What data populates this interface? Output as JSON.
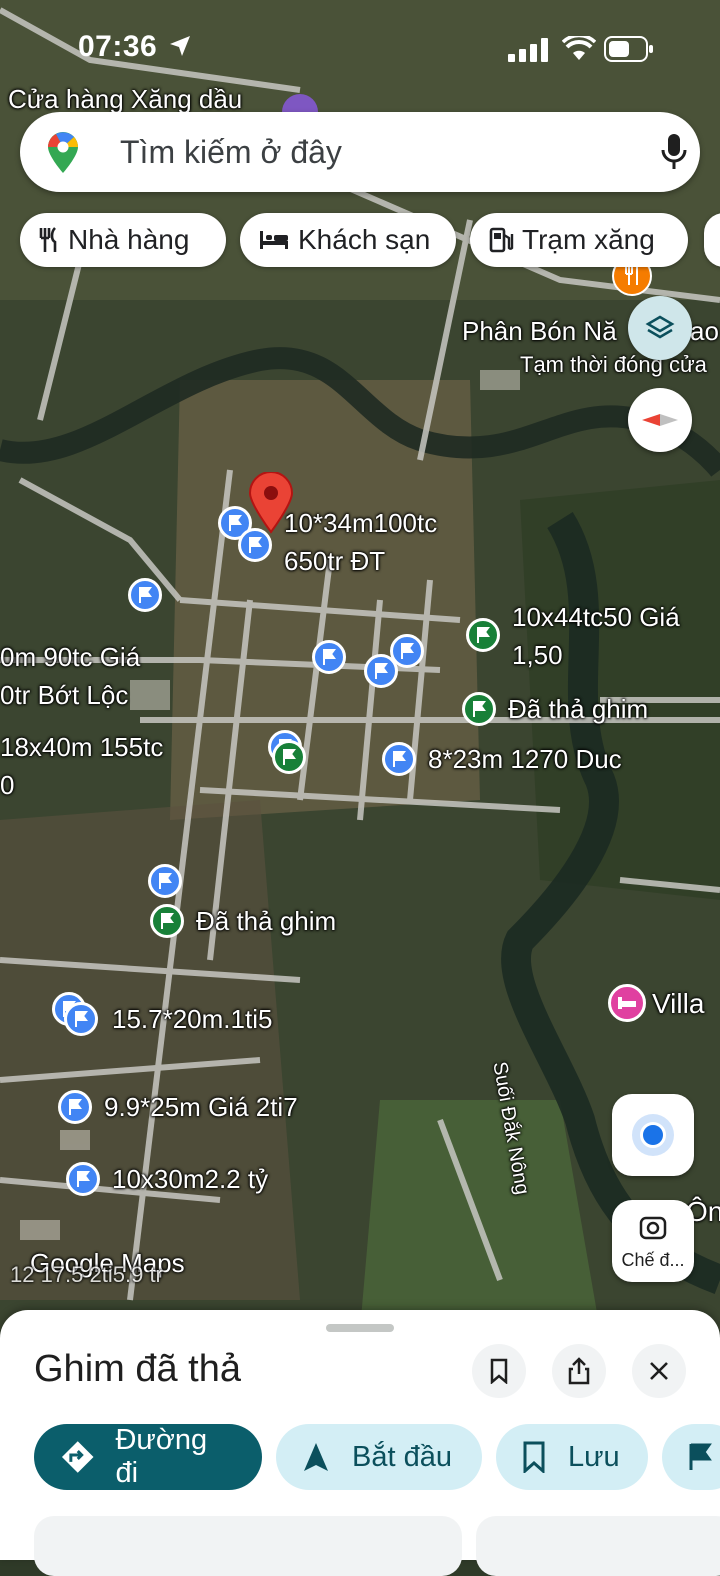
{
  "status_bar": {
    "time": "07:36"
  },
  "search": {
    "placeholder": "Tìm kiếm ở đây"
  },
  "chips": [
    "Nhà hàng",
    "Khách sạn",
    "Trạm xăng"
  ],
  "map_labels": {
    "gas_store": "Cửa hàng Xăng dầu",
    "fertilizer": "Phân Bón Nă",
    "fertilizer_tail": "ao",
    "closed": "Tạm thời đóng cửa",
    "villa": "Villa",
    "stream": "Suối Đắk Nông",
    "on": "Ôn",
    "watermark": "Google Maps",
    "bottom_cut": "12 17.5 2ti5.9 tr"
  },
  "pins": [
    {
      "text": "10*34m100tc\n650tr ĐT"
    },
    {
      "text": "10x44tc50 Giá\n1,50"
    },
    {
      "text": "0m 90tc Giá\n0tr Bớt Lộc"
    },
    {
      "text": "Đã thả ghim"
    },
    {
      "text": "18x40m 155tc\n0"
    },
    {
      "text": "8*23m 1270 Duc"
    },
    {
      "text": "Đã thả ghim"
    },
    {
      "text": "15.7*20m.1ti5"
    },
    {
      "text": "9.9*25m Giá 2ti7"
    },
    {
      "text": "10x30m2.2 tỷ"
    }
  ],
  "lens_label": "Chế đ...",
  "sheet": {
    "title": "Ghim đã thả",
    "actions": [
      "Đường đi",
      "Bắt đầu",
      "Lưu"
    ]
  },
  "colors": {
    "primary": "#0b5e6b",
    "secondary_bg": "#d3eef5",
    "pin_red": "#ea4335",
    "flag_blue": "#4285f4",
    "flag_green": "#188038"
  }
}
